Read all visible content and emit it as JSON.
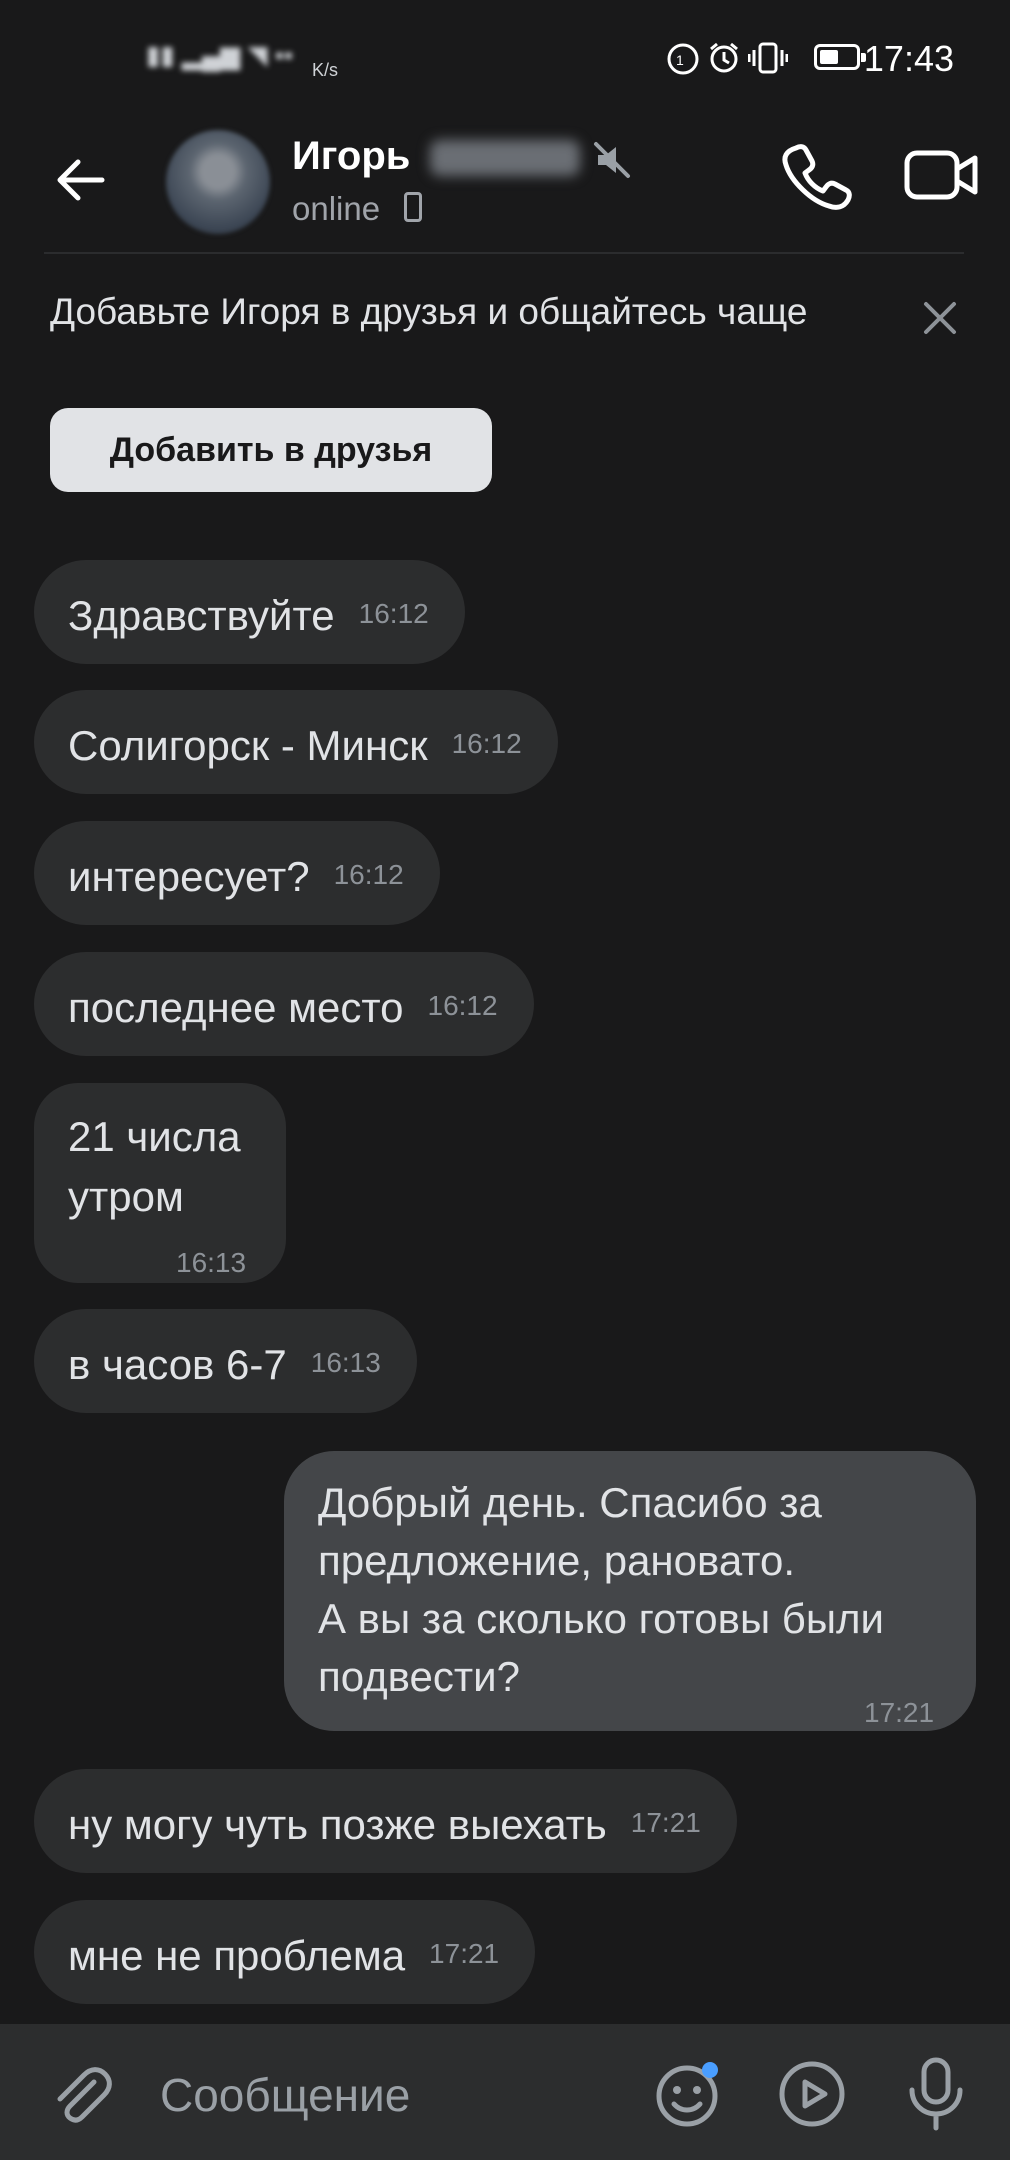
{
  "status_bar": {
    "time": "17:43",
    "network_speed": "K/s"
  },
  "header": {
    "contact_name": "Игорь",
    "status": "online"
  },
  "banner": {
    "text": "Добавьте Игоря в друзья и общайтесь чаще",
    "button": "Добавить в друзья"
  },
  "messages": [
    {
      "text": "Здравствуйте",
      "time": "16:12"
    },
    {
      "text": "Солигорск - Минск",
      "time": "16:12"
    },
    {
      "text": "интересует?",
      "time": "16:12"
    },
    {
      "text": "последнее место",
      "time": "16:12"
    },
    {
      "text": "21 числа",
      "text2": "утром",
      "time": "16:13"
    },
    {
      "text": "в часов 6-7",
      "time": "16:13"
    },
    {
      "lines": [
        "Добрый день. Спасибо за",
        "предложение, рановато.",
        "А вы за сколько готовы были",
        "подвести?"
      ],
      "time": "17:21"
    },
    {
      "text": "ну могу чуть позже выехать",
      "time": "17:21"
    },
    {
      "text": "мне не проблема",
      "time": "17:21"
    }
  ],
  "composer": {
    "placeholder": "Сообщение"
  },
  "icons": [
    "back-arrow-icon",
    "mute-icon",
    "phone-icon",
    "video-camera-icon",
    "close-icon",
    "attach-icon",
    "emoji-icon",
    "play-icon",
    "microphone-icon"
  ],
  "colors": {
    "background": "#19191a",
    "incoming_bubble": "#2c2d2e",
    "outgoing_bubble": "#444649",
    "accent_dot": "#4a9eff"
  }
}
